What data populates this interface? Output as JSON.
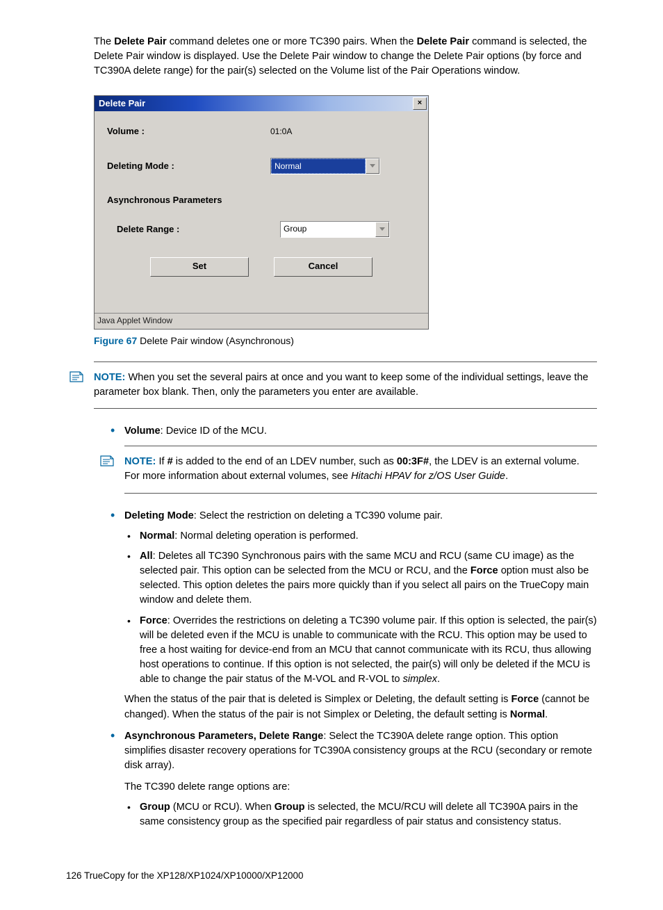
{
  "intro": {
    "part1": "The ",
    "bold1": "Delete Pair",
    "part2": " command deletes one or more TC390 pairs. When the ",
    "bold2": "Delete Pair",
    "part3": " command is selected, the Delete Pair window is displayed. Use the Delete Pair window to change the Delete Pair options (by force and TC390A delete range) for the pair(s) selected on the Volume list of the Pair Operations window."
  },
  "dialog": {
    "title": "Delete Pair",
    "close_glyph": "×",
    "volume_label": "Volume :",
    "volume_value": "01:0A",
    "deleting_mode_label": "Deleting Mode :",
    "deleting_mode_value": "Normal",
    "async_label": "Asynchronous Parameters",
    "delete_range_label": "Delete Range :",
    "delete_range_value": "Group",
    "set_label": "Set",
    "cancel_label": "Cancel",
    "status": "Java Applet Window"
  },
  "figcap": {
    "id": "Figure 67",
    "text": "  Delete Pair window (Asynchronous)"
  },
  "note1": {
    "label": "NOTE:",
    "text": "   When you set the several pairs at once and you want to keep some of the individual settings, leave the parameter box blank. Then, only the parameters you enter are available."
  },
  "bullet_volume": {
    "b": "Volume",
    "rest": ": Device ID of the MCU."
  },
  "note2": {
    "label": "NOTE:",
    "p1": "   If ",
    "b1": "#",
    "p2": " is added to the end of an LDEV number, such as ",
    "b2": "00:3F#",
    "p3": ", the LDEV is an external volume. For more information about external volumes, see ",
    "i1": "Hitachi HPAV for z/OS User Guide",
    "p4": "."
  },
  "bullet_dm": {
    "b": "Deleting Mode",
    "rest": ": Select the restriction on deleting a TC390 volume pair."
  },
  "dm_normal": {
    "b": "Normal",
    "rest": ": Normal deleting operation is performed."
  },
  "dm_all": {
    "b": "All",
    "p1": ": Deletes all TC390 Synchronous pairs with the same MCU and RCU (same CU image) as the selected pair. This option can be selected from the MCU or RCU, and the ",
    "b2": "Force",
    "p2": " option must also be selected. This option deletes the pairs more quickly than if you select all pairs on the TrueCopy main window and delete them."
  },
  "dm_force": {
    "b": "Force",
    "p1": ": Overrides the restrictions on deleting a TC390 volume pair. If this option is selected, the pair(s) will be deleted even if the MCU is unable to communicate with the RCU. This option may be used to free a host waiting for device-end from an MCU that cannot communicate with its RCU, thus allowing host operations to continue. If this option is not selected, the pair(s) will only be deleted if the MCU is able to change the pair status of the M-VOL and R-VOL to ",
    "i1": "simplex",
    "p2": "."
  },
  "dm_tail": {
    "p1": "When the status of the pair that is deleted is Simplex or Deleting, the default setting is ",
    "b1": "Force",
    "p2": " (cannot be changed). When the status of the pair is not Simplex or Deleting, the default setting is ",
    "b2": "Normal",
    "p3": "."
  },
  "bullet_async": {
    "b": "Asynchronous Parameters, Delete Range",
    "p1": ": Select the TC390A delete range option. This option simplifies disaster recovery operations for TC390A consistency groups at the RCU (secondary or remote disk array).",
    "p2": "The TC390 delete range options are:"
  },
  "async_group": {
    "b1": "Group",
    "p1": " (MCU or RCU). When ",
    "b2": "Group",
    "p2": " is selected, the MCU/RCU will delete all TC390A pairs in the same consistency group as the specified pair regardless of pair status and consistency status."
  },
  "footer": {
    "page": "126",
    "title": "   TrueCopy for the XP128/XP1024/XP10000/XP12000"
  }
}
